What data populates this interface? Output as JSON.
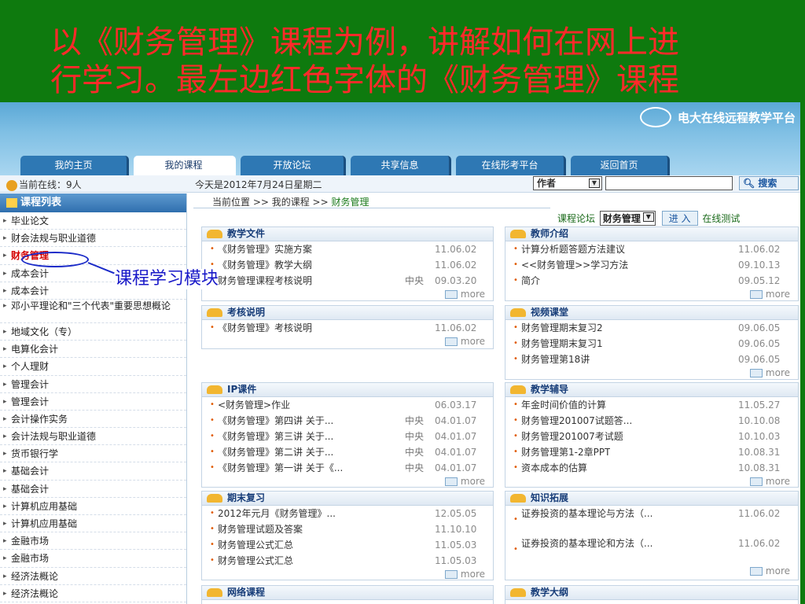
{
  "slide": {
    "title_line1": "以《财务管理》课程为例，讲解如何在网上进",
    "title_line2": "行学习。最左边红色字体的《财务管理》课程",
    "callout": "课程学习模块",
    "colors": {
      "slide_bg": "#0e7a0e",
      "title": "#ff2a2a",
      "callout": "#1818c8"
    }
  },
  "site": {
    "logo_text": "电大在线远程教学平台"
  },
  "tabs": [
    "我的主页",
    "我的课程",
    "开放论坛",
    "共享信息",
    "在线形考平台",
    "返回首页"
  ],
  "active_tab": "我的课程",
  "infobar": {
    "online": "当前在线：9人",
    "date": "今天是2012年7月24日星期二",
    "search_select": "作者",
    "search_button": "搜索"
  },
  "sidebar": {
    "title": "课程列表",
    "items": [
      "毕业论文",
      "财会法规与职业道德",
      "财务管理",
      "成本会计",
      "成本会计",
      "邓小平理论和\"三个代表\"重要思想概论",
      "地域文化（专）",
      "电算化会计",
      "个人理财",
      "管理会计",
      "管理会计",
      "会计操作实务",
      "会计法规与职业道德",
      "货币银行学",
      "基础会计",
      "基础会计",
      "计算机应用基础",
      "计算机应用基础",
      "金融市场",
      "金融市场",
      "经济法概论",
      "经济法概论"
    ]
  },
  "breadcrumb": {
    "prefix": "当前位置 >> 我的课程 >>",
    "current": "财务管理"
  },
  "forum": {
    "label": "课程论坛",
    "select": "财务管理",
    "button": "进 入",
    "test": "在线测试"
  },
  "more_label": "more",
  "panels": {
    "teaching_files": {
      "title": "教学文件",
      "items": [
        {
          "t": "《财务管理》实施方案",
          "s": "",
          "d": "11.06.02"
        },
        {
          "t": "《财务管理》教学大纲",
          "s": "",
          "d": "11.06.02"
        },
        {
          "t": "财务管理课程考核说明",
          "s": "中央",
          "d": "09.03.20"
        }
      ]
    },
    "teacher_intro": {
      "title": "教师介绍",
      "items": [
        {
          "t": "计算分析题答题方法建议",
          "d": "11.06.02"
        },
        {
          "t": "<<财务管理>>学习方法",
          "d": "09.10.13"
        },
        {
          "t": "简介",
          "d": "09.05.12"
        }
      ]
    },
    "exam_notes": {
      "title": "考核说明",
      "items": [
        {
          "t": "《财务管理》考核说明",
          "s": "",
          "d": "11.06.02"
        }
      ]
    },
    "video": {
      "title": "视频课堂",
      "items": [
        {
          "t": "财务管理期末复习2",
          "d": "09.06.05"
        },
        {
          "t": "财务管理期末复习1",
          "d": "09.06.05"
        },
        {
          "t": "财务管理第18讲",
          "d": "09.06.05"
        }
      ]
    },
    "ip_courses": {
      "title": "IP课件",
      "items": [
        {
          "t": "<财务管理>作业",
          "s": "",
          "d": "06.03.17"
        },
        {
          "t": "《财务管理》第四讲 关于...",
          "s": "中央",
          "d": "04.01.07"
        },
        {
          "t": "《财务管理》第三讲 关于...",
          "s": "中央",
          "d": "04.01.07"
        },
        {
          "t": "《财务管理》第二讲 关于...",
          "s": "中央",
          "d": "04.01.07"
        },
        {
          "t": "《财务管理》第一讲 关于《...",
          "s": "中央",
          "d": "04.01.07"
        }
      ]
    },
    "tutoring": {
      "title": "教学辅导",
      "items": [
        {
          "t": "年金时间价值的计算",
          "d": "11.05.27"
        },
        {
          "t": "财务管理201007试题答...",
          "d": "10.10.08"
        },
        {
          "t": "财务管理201007考试题",
          "d": "10.10.03"
        },
        {
          "t": "财务管理第1-2章PPT",
          "d": "10.08.31"
        },
        {
          "t": "资本成本的估算",
          "d": "10.08.31"
        }
      ]
    },
    "final_review": {
      "title": "期末复习",
      "items": [
        {
          "t": "2012年元月《财务管理》...",
          "s": "",
          "d": "12.05.05"
        },
        {
          "t": "财务管理试题及答案",
          "s": "",
          "d": "11.10.10"
        },
        {
          "t": "财务管理公式汇总",
          "s": "",
          "d": "11.05.03"
        },
        {
          "t": "财务管理公式汇总",
          "s": "",
          "d": "11.05.03"
        }
      ]
    },
    "knowledge": {
      "title": "知识拓展",
      "items": [
        {
          "t": "证券投资的基本理论与方法（...",
          "d": "11.06.02"
        },
        {
          "t": "证券投资的基本理论和方法（...",
          "d": "11.06.02"
        }
      ]
    },
    "network_course": {
      "title": "网络课程"
    },
    "syllabus": {
      "title": "教学大纲"
    }
  }
}
